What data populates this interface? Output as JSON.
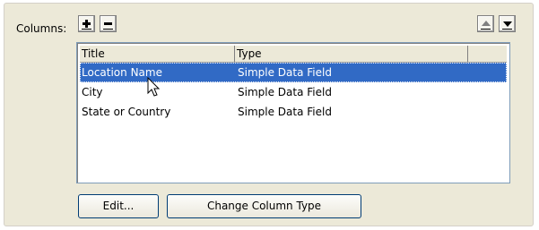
{
  "columns_label": "Columns:",
  "toolbar": {
    "add_icon": "plus-icon",
    "remove_icon": "minus-icon",
    "move_up_icon": "arrow-up-icon",
    "move_down_icon": "arrow-down-icon"
  },
  "table": {
    "headers": [
      "Title",
      "Type"
    ],
    "rows": [
      {
        "title": "Location Name",
        "type": "Simple Data Field",
        "selected": true
      },
      {
        "title": "City",
        "type": "Simple Data Field",
        "selected": false
      },
      {
        "title": "State or Country",
        "type": "Simple Data Field",
        "selected": false
      }
    ]
  },
  "buttons": {
    "edit_label": "Edit...",
    "change_type_label": "Change Column Type"
  },
  "colors": {
    "panel": "#ece9d8",
    "selection": "#316ac5",
    "border": "#7f9db9"
  }
}
